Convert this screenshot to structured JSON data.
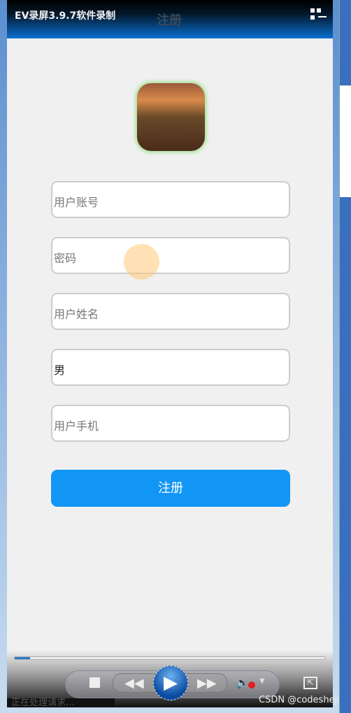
{
  "recorder": {
    "title": "EV录屏3.9.7软件录制",
    "status": "正在处理请求..."
  },
  "header": {
    "title": "注册"
  },
  "form": {
    "username_placeholder": "用户账号",
    "password_placeholder": "密码",
    "name_placeholder": "用户姓名",
    "gender_value": "男",
    "phone_placeholder": "用户手机",
    "submit_label": "注册"
  },
  "player": {
    "progress_percent": 5,
    "play": "▶",
    "rewind": "◀◀",
    "forward": "▶▶",
    "volume": "🔈",
    "dropdown": "▼",
    "fullscreen": "⇱"
  },
  "watermark": "CSDN @codesheji",
  "colors": {
    "accent": "#1296f6",
    "header": "#0a6fd0"
  }
}
